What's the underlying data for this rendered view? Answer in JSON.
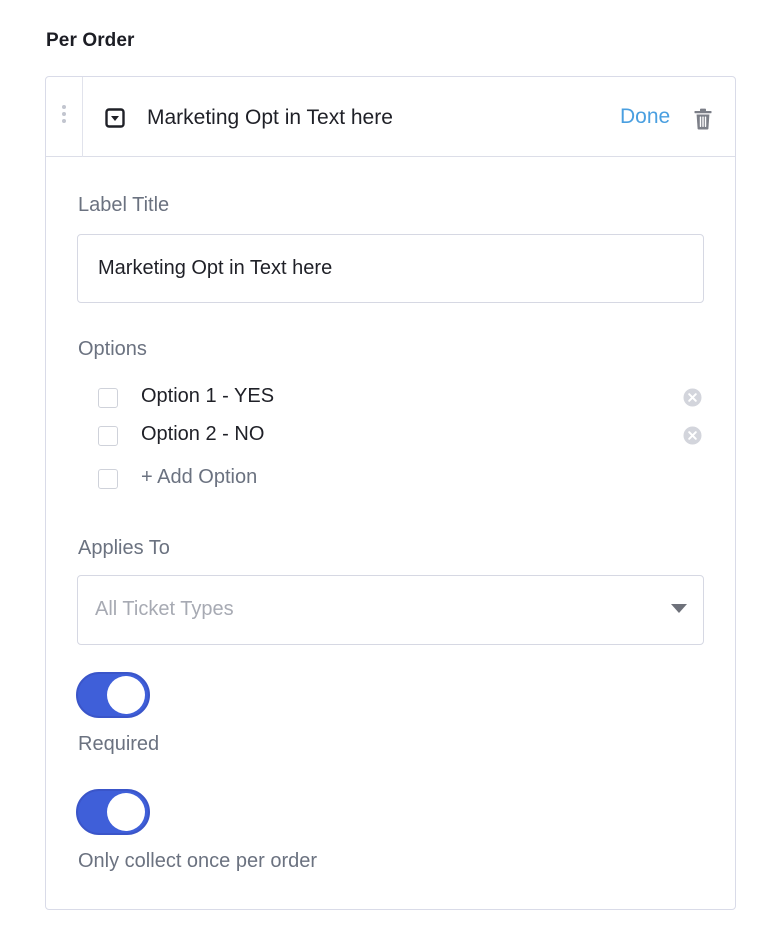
{
  "section": {
    "heading": "Per Order"
  },
  "question": {
    "title": "Marketing Opt in Text here",
    "done_label": "Done",
    "type_icon": "dropdown-icon",
    "delete_icon": "trash-icon"
  },
  "label_title": {
    "label": "Label Title",
    "value": "Marketing Opt in Text here"
  },
  "options": {
    "label": "Options",
    "items": [
      {
        "text": "Option 1 - YES",
        "checked": false
      },
      {
        "text": "Option 2 - NO",
        "checked": false
      }
    ],
    "add_label": "+ Add Option"
  },
  "applies_to": {
    "label": "Applies To",
    "selected": "All Ticket Types"
  },
  "toggles": [
    {
      "label": "Required",
      "on": true
    },
    {
      "label": "Only collect once per order",
      "on": true
    }
  ],
  "colors": {
    "accent": "#3f5fd9",
    "link": "#4a9fe0",
    "border": "#d9dbe8",
    "muted_text": "#6b7280"
  }
}
